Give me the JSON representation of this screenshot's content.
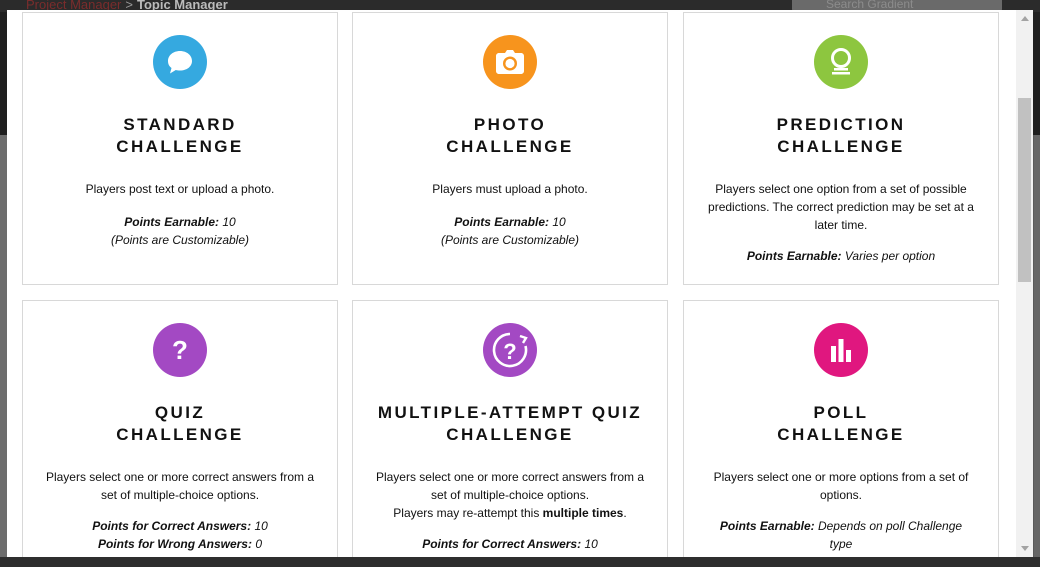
{
  "background": {
    "breadcrumb": [
      "Project Manager",
      "Topic Manager"
    ],
    "search_placeholder": "Search Gradient"
  },
  "colors": {
    "standard": "#35a9e0",
    "photo": "#f7941d",
    "prediction": "#8dc63f",
    "quiz": "#a349c3",
    "multi_quiz": "#a349c3",
    "poll": "#e0177f"
  },
  "cards": {
    "standard": {
      "icon": "speech-bubble-icon",
      "title_line1": "STANDARD",
      "title_line2": "CHALLENGE",
      "description": "Players post text or upload a photo.",
      "points_label": "Points Earnable:",
      "points_value": "10",
      "note": "(Points are Customizable)"
    },
    "photo": {
      "icon": "camera-icon",
      "title_line1": "PHOTO",
      "title_line2": "CHALLENGE",
      "description": "Players must upload a photo.",
      "points_label": "Points Earnable:",
      "points_value": "10",
      "note": "(Points are Customizable)"
    },
    "prediction": {
      "icon": "crystal-ball-icon",
      "title_line1": "PREDICTION",
      "title_line2": "CHALLENGE",
      "description": "Players select one option from a set of possible predictions. The correct prediction may be set at a later time.",
      "points_label": "Points Earnable:",
      "points_value": "Varies per option"
    },
    "quiz": {
      "icon": "question-mark-icon",
      "title_line1": "QUIZ",
      "title_line2": "CHALLENGE",
      "description": "Players select one or more correct answers from a set of multiple-choice options.",
      "correct_label": "Points for Correct Answers:",
      "correct_value": "10",
      "wrong_label": "Points for Wrong Answers:",
      "wrong_value": "0"
    },
    "multi_quiz": {
      "icon": "retry-question-icon",
      "title_line1": "MULTIPLE-ATTEMPT QUIZ",
      "title_line2": "CHALLENGE",
      "description": "Players select one or more correct answers from a set of multiple-choice options.",
      "retry_prefix": "Players may re-attempt this",
      "retry_bold": "multiple times",
      "retry_suffix": ".",
      "correct_label": "Points for Correct Answers:",
      "correct_value": "10"
    },
    "poll": {
      "icon": "bar-chart-icon",
      "title_line1": "POLL",
      "title_line2": "CHALLENGE",
      "description": "Players select one or more options from a set of options.",
      "points_label": "Points Earnable:",
      "points_value": "Depends on poll Challenge type"
    }
  }
}
